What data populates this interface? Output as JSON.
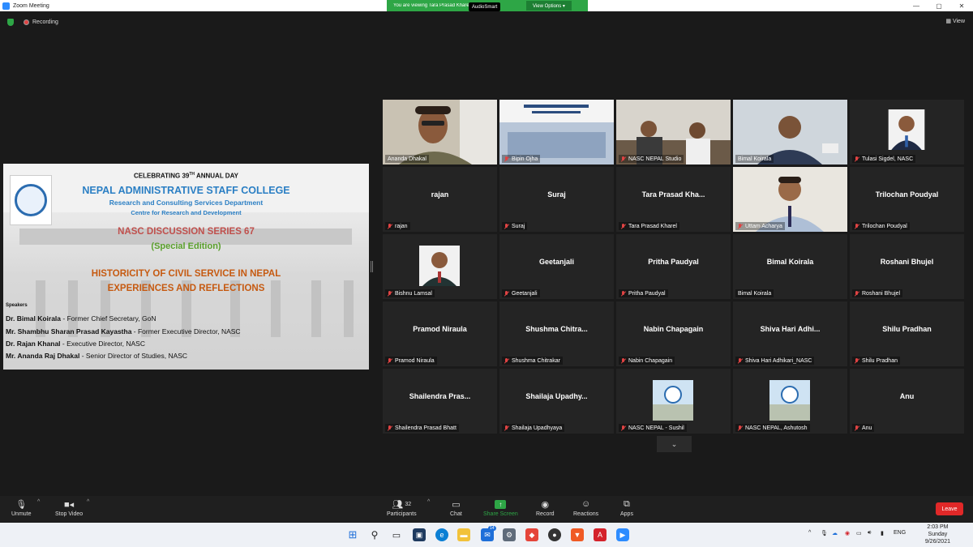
{
  "window": {
    "title": "Zoom Meeting",
    "minimize": "—",
    "maximize": "▢",
    "close": "✕"
  },
  "share_banner": {
    "message": "You are viewing Tara Prasad Kharel's screen",
    "view_options": "View Options ▾",
    "audiosmart": "AudioSmart"
  },
  "topbar": {
    "recording": "Recording",
    "view": "View"
  },
  "slide": {
    "celebrating": "CELEBRATING 39",
    "celebrating_sup": "TH",
    "celebrating_rest": " ANNUAL DAY",
    "college": "NEPAL ADMINISTRATIVE STAFF COLLEGE",
    "department": "Research and Consulting Services Department",
    "centre": "Centre for Research and Development",
    "series": "NASC DISCUSSION SERIES 67",
    "special": "(Special Edition)",
    "title_line1": "HISTORICITY OF CIVIL SERVICE IN NEPAL",
    "title_line2": "EXPERIENCES AND REFLECTIONS",
    "speakers_heading": "Speakers",
    "speakers": [
      {
        "name": "Dr. Bimal Koirala",
        "role": " - Former Chief Secretary, GoN"
      },
      {
        "name": "Mr. Shambhu Sharan Prasad Kayastha",
        "role": " - Former Executive Director, NASC"
      },
      {
        "name": "Dr. Rajan Khanal",
        "role": " - Executive Director, NASC"
      },
      {
        "name": "Mr. Ananda Raj Dhakal",
        "role": " - Senior Director of Studies, NASC"
      }
    ]
  },
  "participants_grid": [
    {
      "center": "",
      "label": "Ananda Dhakal"
    },
    {
      "center": "",
      "label": "Bipin Ojha"
    },
    {
      "center": "",
      "label": "NASC NEPAL Studio"
    },
    {
      "center": "",
      "label": "Bimal Koirala"
    },
    {
      "center": "",
      "label": "Tulasi Sigdel, NASC"
    },
    {
      "center": "rajan",
      "label": "rajan"
    },
    {
      "center": "Suraj",
      "label": "Suraj"
    },
    {
      "center": "Tara Prasad Kha...",
      "label": "Tara Prasad Kharel"
    },
    {
      "center": "",
      "label": "Uttam Acharya"
    },
    {
      "center": "Trilochan Poudyal",
      "label": "Trilochan Poudyal"
    },
    {
      "center": "",
      "label": "Bishnu Lamsal"
    },
    {
      "center": "Geetanjali",
      "label": "Geetanjali"
    },
    {
      "center": "Pritha Paudyal",
      "label": "Pritha Paudyal"
    },
    {
      "center": "Bimal Koirala",
      "label": "Bimal Koirala"
    },
    {
      "center": "Roshani Bhujel",
      "label": "Roshani Bhujel"
    },
    {
      "center": "Pramod Niraula",
      "label": "Pramod Niraula"
    },
    {
      "center": "Shushma  Chitra...",
      "label": "Shushma Chitrakar"
    },
    {
      "center": "Nabin Chapagain",
      "label": "Nabin Chapagain"
    },
    {
      "center": "Shiva  Hari  Adhi...",
      "label": "Shiva Hari Adhikari_NASC"
    },
    {
      "center": "Shilu Pradhan",
      "label": "Shilu Pradhan"
    },
    {
      "center": "Shailendra  Pras...",
      "label": "Shailendra Prasad Bhatt"
    },
    {
      "center": "Shailaja  Upadhy...",
      "label": "Shailaja Upadhyaya"
    },
    {
      "center": "",
      "label": "NASC NEPAL - Sushil"
    },
    {
      "center": "",
      "label": "NASC NEPAL, Ashutosh"
    },
    {
      "center": "Anu",
      "label": "Anu"
    }
  ],
  "controls": {
    "unmute": "Unmute",
    "stop_video": "Stop Video",
    "participants": "Participants",
    "participants_count": "32",
    "chat": "Chat",
    "share_screen": "Share Screen",
    "record": "Record",
    "reactions": "Reactions",
    "apps": "Apps",
    "leave": "Leave"
  },
  "taskbar": {
    "language": "ENG",
    "time": "2:03 PM",
    "day": "Sunday",
    "date": "9/26/2021",
    "mail_badge": "14"
  },
  "colors": {
    "zoom_blue": "#2d8cff",
    "share_green": "#2ea646",
    "leave_red": "#e02828",
    "active_speaker": "#b7e03c"
  }
}
